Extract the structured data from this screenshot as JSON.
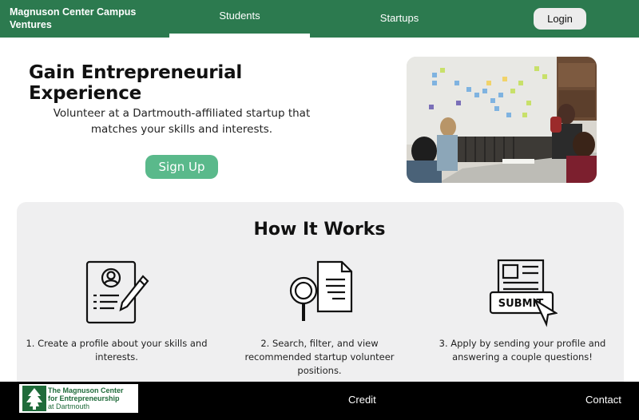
{
  "nav": {
    "brand": "Magnuson Center Campus Ventures",
    "tabs": [
      {
        "label": "Students",
        "active": true
      },
      {
        "label": "Startups",
        "active": false
      }
    ],
    "login_label": "Login"
  },
  "hero": {
    "title": "Gain Entrepreneurial Experience",
    "subtitle": "Volunteer at a Dartmouth-affiliated startup that matches your skills and interests.",
    "signup_label": "Sign Up"
  },
  "how_it_works": {
    "title": "How It Works",
    "steps": [
      {
        "icon": "profile-form-icon",
        "text": "1. Create a profile about your skills and interests."
      },
      {
        "icon": "search-document-icon",
        "text": "2. Search, filter, and view recommended startup volunteer positions."
      },
      {
        "icon": "submit-icon",
        "text": "3. Apply by sending your profile and answering a couple questions!",
        "icon_label": "SUBMIT"
      }
    ]
  },
  "footer": {
    "logo_line1": "The Magnuson Center",
    "logo_line2": "for Entrepreneurship",
    "logo_line3": "at Dartmouth",
    "links": [
      "Credit",
      "Contact"
    ]
  },
  "colors": {
    "nav_green": "#2c7a4f",
    "button_green": "#5ab98b",
    "panel_gray": "#efeff0",
    "footer_black": "#000000"
  }
}
